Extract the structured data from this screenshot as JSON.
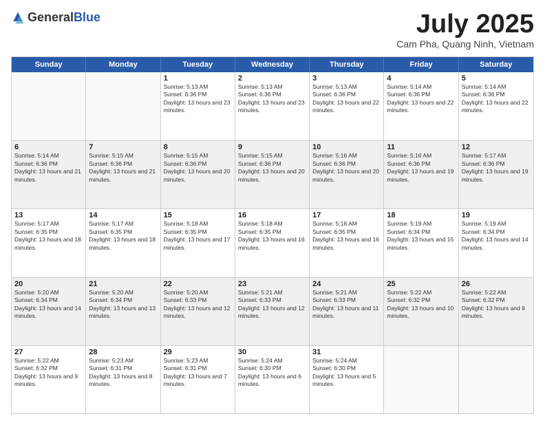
{
  "header": {
    "logo_general": "General",
    "logo_blue": "Blue",
    "month": "July 2025",
    "location": "Cam Pha, Quang Ninh, Vietnam"
  },
  "calendar": {
    "days": [
      "Sunday",
      "Monday",
      "Tuesday",
      "Wednesday",
      "Thursday",
      "Friday",
      "Saturday"
    ],
    "rows": [
      [
        {
          "day": "",
          "empty": true
        },
        {
          "day": "",
          "empty": true
        },
        {
          "day": "1",
          "sunrise": "5:13 AM",
          "sunset": "6:36 PM",
          "daylight": "13 hours and 23 minutes."
        },
        {
          "day": "2",
          "sunrise": "5:13 AM",
          "sunset": "6:36 PM",
          "daylight": "13 hours and 23 minutes."
        },
        {
          "day": "3",
          "sunrise": "5:13 AM",
          "sunset": "6:36 PM",
          "daylight": "13 hours and 22 minutes."
        },
        {
          "day": "4",
          "sunrise": "5:14 AM",
          "sunset": "6:36 PM",
          "daylight": "13 hours and 22 minutes."
        },
        {
          "day": "5",
          "sunrise": "5:14 AM",
          "sunset": "6:36 PM",
          "daylight": "13 hours and 22 minutes."
        }
      ],
      [
        {
          "day": "6",
          "sunrise": "5:14 AM",
          "sunset": "6:36 PM",
          "daylight": "13 hours and 21 minutes."
        },
        {
          "day": "7",
          "sunrise": "5:15 AM",
          "sunset": "6:36 PM",
          "daylight": "13 hours and 21 minutes."
        },
        {
          "day": "8",
          "sunrise": "5:15 AM",
          "sunset": "6:36 PM",
          "daylight": "13 hours and 20 minutes."
        },
        {
          "day": "9",
          "sunrise": "5:15 AM",
          "sunset": "6:36 PM",
          "daylight": "13 hours and 20 minutes."
        },
        {
          "day": "10",
          "sunrise": "5:16 AM",
          "sunset": "6:36 PM",
          "daylight": "13 hours and 20 minutes."
        },
        {
          "day": "11",
          "sunrise": "5:16 AM",
          "sunset": "6:36 PM",
          "daylight": "13 hours and 19 minutes."
        },
        {
          "day": "12",
          "sunrise": "5:17 AM",
          "sunset": "6:36 PM",
          "daylight": "13 hours and 19 minutes."
        }
      ],
      [
        {
          "day": "13",
          "sunrise": "5:17 AM",
          "sunset": "6:35 PM",
          "daylight": "13 hours and 18 minutes."
        },
        {
          "day": "14",
          "sunrise": "5:17 AM",
          "sunset": "6:35 PM",
          "daylight": "13 hours and 18 minutes."
        },
        {
          "day": "15",
          "sunrise": "5:18 AM",
          "sunset": "6:35 PM",
          "daylight": "13 hours and 17 minutes."
        },
        {
          "day": "16",
          "sunrise": "5:18 AM",
          "sunset": "6:35 PM",
          "daylight": "13 hours and 16 minutes."
        },
        {
          "day": "17",
          "sunrise": "5:18 AM",
          "sunset": "6:35 PM",
          "daylight": "13 hours and 16 minutes."
        },
        {
          "day": "18",
          "sunrise": "5:19 AM",
          "sunset": "6:34 PM",
          "daylight": "13 hours and 15 minutes."
        },
        {
          "day": "19",
          "sunrise": "5:19 AM",
          "sunset": "6:34 PM",
          "daylight": "13 hours and 14 minutes."
        }
      ],
      [
        {
          "day": "20",
          "sunrise": "5:20 AM",
          "sunset": "6:34 PM",
          "daylight": "13 hours and 14 minutes."
        },
        {
          "day": "21",
          "sunrise": "5:20 AM",
          "sunset": "6:34 PM",
          "daylight": "13 hours and 13 minutes."
        },
        {
          "day": "22",
          "sunrise": "5:20 AM",
          "sunset": "6:33 PM",
          "daylight": "13 hours and 12 minutes."
        },
        {
          "day": "23",
          "sunrise": "5:21 AM",
          "sunset": "6:33 PM",
          "daylight": "13 hours and 12 minutes."
        },
        {
          "day": "24",
          "sunrise": "5:21 AM",
          "sunset": "6:33 PM",
          "daylight": "13 hours and 11 minutes."
        },
        {
          "day": "25",
          "sunrise": "5:22 AM",
          "sunset": "6:32 PM",
          "daylight": "13 hours and 10 minutes."
        },
        {
          "day": "26",
          "sunrise": "5:22 AM",
          "sunset": "6:32 PM",
          "daylight": "13 hours and 9 minutes."
        }
      ],
      [
        {
          "day": "27",
          "sunrise": "5:22 AM",
          "sunset": "6:32 PM",
          "daylight": "13 hours and 9 minutes."
        },
        {
          "day": "28",
          "sunrise": "5:23 AM",
          "sunset": "6:31 PM",
          "daylight": "13 hours and 8 minutes."
        },
        {
          "day": "29",
          "sunrise": "5:23 AM",
          "sunset": "6:31 PM",
          "daylight": "13 hours and 7 minutes."
        },
        {
          "day": "30",
          "sunrise": "5:24 AM",
          "sunset": "6:30 PM",
          "daylight": "13 hours and 6 minutes."
        },
        {
          "day": "31",
          "sunrise": "5:24 AM",
          "sunset": "6:30 PM",
          "daylight": "13 hours and 5 minutes."
        },
        {
          "day": "",
          "empty": true
        },
        {
          "day": "",
          "empty": true
        }
      ]
    ]
  }
}
